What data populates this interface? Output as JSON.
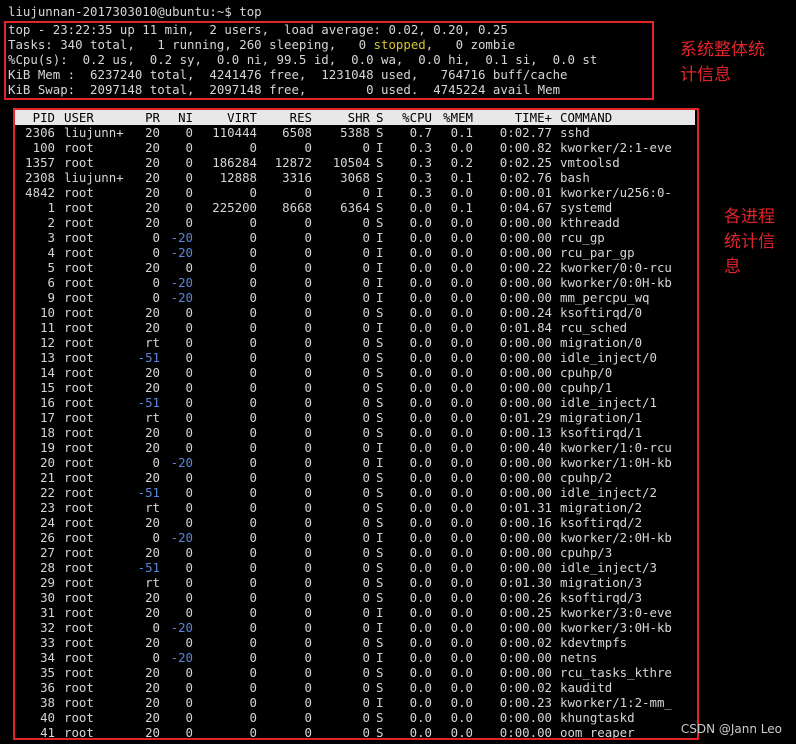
{
  "prompt": "liujunnan-2017303010@ubuntu:~$ top",
  "summary": {
    "line1": "top - 23:22:35 up 11 min,  2 users,  load average: 0.02, 0.20, 0.25",
    "line2_pre": "Tasks: 340 total,   1 running, 260 sleeping,   0 ",
    "line2_stopped": "stopped",
    "line2_post": ",   0 zombie",
    "line3": "%Cpu(s):  0.2 us,  0.2 sy,  0.0 ni, 99.5 id,  0.0 wa,  0.0 hi,  0.1 si,  0.0 st",
    "line4": "KiB Mem :  6237240 total,  4241476 free,  1231048 used,   764716 buff/cache",
    "line5": "KiB Swap:  2097148 total,  2097148 free,        0 used.  4745224 avail Mem"
  },
  "columns": [
    "PID",
    "USER",
    "PR",
    "NI",
    "VIRT",
    "RES",
    "SHR",
    "S",
    "%CPU",
    "%MEM",
    "TIME+",
    "COMMAND"
  ],
  "processes": [
    [
      "2306",
      "liujunn+",
      "20",
      "0",
      "110444",
      "6508",
      "5388",
      "S",
      "0.7",
      "0.1",
      "0:02.77",
      "sshd"
    ],
    [
      "100",
      "root",
      "20",
      "0",
      "0",
      "0",
      "0",
      "I",
      "0.3",
      "0.0",
      "0:00.82",
      "kworker/2:1-eve"
    ],
    [
      "1357",
      "root",
      "20",
      "0",
      "186284",
      "12872",
      "10504",
      "S",
      "0.3",
      "0.2",
      "0:02.25",
      "vmtoolsd"
    ],
    [
      "2308",
      "liujunn+",
      "20",
      "0",
      "12888",
      "3316",
      "3068",
      "S",
      "0.3",
      "0.1",
      "0:02.76",
      "bash"
    ],
    [
      "4842",
      "root",
      "20",
      "0",
      "0",
      "0",
      "0",
      "I",
      "0.3",
      "0.0",
      "0:00.01",
      "kworker/u256:0-"
    ],
    [
      "1",
      "root",
      "20",
      "0",
      "225200",
      "8668",
      "6364",
      "S",
      "0.0",
      "0.1",
      "0:04.67",
      "systemd"
    ],
    [
      "2",
      "root",
      "20",
      "0",
      "0",
      "0",
      "0",
      "S",
      "0.0",
      "0.0",
      "0:00.00",
      "kthreadd"
    ],
    [
      "3",
      "root",
      "0",
      "-20",
      "0",
      "0",
      "0",
      "I",
      "0.0",
      "0.0",
      "0:00.00",
      "rcu_gp"
    ],
    [
      "4",
      "root",
      "0",
      "-20",
      "0",
      "0",
      "0",
      "I",
      "0.0",
      "0.0",
      "0:00.00",
      "rcu_par_gp"
    ],
    [
      "5",
      "root",
      "20",
      "0",
      "0",
      "0",
      "0",
      "I",
      "0.0",
      "0.0",
      "0:00.22",
      "kworker/0:0-rcu"
    ],
    [
      "6",
      "root",
      "0",
      "-20",
      "0",
      "0",
      "0",
      "I",
      "0.0",
      "0.0",
      "0:00.00",
      "kworker/0:0H-kb"
    ],
    [
      "9",
      "root",
      "0",
      "-20",
      "0",
      "0",
      "0",
      "I",
      "0.0",
      "0.0",
      "0:00.00",
      "mm_percpu_wq"
    ],
    [
      "10",
      "root",
      "20",
      "0",
      "0",
      "0",
      "0",
      "S",
      "0.0",
      "0.0",
      "0:00.24",
      "ksoftirqd/0"
    ],
    [
      "11",
      "root",
      "20",
      "0",
      "0",
      "0",
      "0",
      "I",
      "0.0",
      "0.0",
      "0:01.84",
      "rcu_sched"
    ],
    [
      "12",
      "root",
      "rt",
      "0",
      "0",
      "0",
      "0",
      "S",
      "0.0",
      "0.0",
      "0:00.00",
      "migration/0"
    ],
    [
      "13",
      "root",
      "-51",
      "0",
      "0",
      "0",
      "0",
      "S",
      "0.0",
      "0.0",
      "0:00.00",
      "idle_inject/0"
    ],
    [
      "14",
      "root",
      "20",
      "0",
      "0",
      "0",
      "0",
      "S",
      "0.0",
      "0.0",
      "0:00.00",
      "cpuhp/0"
    ],
    [
      "15",
      "root",
      "20",
      "0",
      "0",
      "0",
      "0",
      "S",
      "0.0",
      "0.0",
      "0:00.00",
      "cpuhp/1"
    ],
    [
      "16",
      "root",
      "-51",
      "0",
      "0",
      "0",
      "0",
      "S",
      "0.0",
      "0.0",
      "0:00.00",
      "idle_inject/1"
    ],
    [
      "17",
      "root",
      "rt",
      "0",
      "0",
      "0",
      "0",
      "S",
      "0.0",
      "0.0",
      "0:01.29",
      "migration/1"
    ],
    [
      "18",
      "root",
      "20",
      "0",
      "0",
      "0",
      "0",
      "S",
      "0.0",
      "0.0",
      "0:00.13",
      "ksoftirqd/1"
    ],
    [
      "19",
      "root",
      "20",
      "0",
      "0",
      "0",
      "0",
      "I",
      "0.0",
      "0.0",
      "0:00.40",
      "kworker/1:0-rcu"
    ],
    [
      "20",
      "root",
      "0",
      "-20",
      "0",
      "0",
      "0",
      "I",
      "0.0",
      "0.0",
      "0:00.00",
      "kworker/1:0H-kb"
    ],
    [
      "21",
      "root",
      "20",
      "0",
      "0",
      "0",
      "0",
      "S",
      "0.0",
      "0.0",
      "0:00.00",
      "cpuhp/2"
    ],
    [
      "22",
      "root",
      "-51",
      "0",
      "0",
      "0",
      "0",
      "S",
      "0.0",
      "0.0",
      "0:00.00",
      "idle_inject/2"
    ],
    [
      "23",
      "root",
      "rt",
      "0",
      "0",
      "0",
      "0",
      "S",
      "0.0",
      "0.0",
      "0:01.31",
      "migration/2"
    ],
    [
      "24",
      "root",
      "20",
      "0",
      "0",
      "0",
      "0",
      "S",
      "0.0",
      "0.0",
      "0:00.16",
      "ksoftirqd/2"
    ],
    [
      "26",
      "root",
      "0",
      "-20",
      "0",
      "0",
      "0",
      "I",
      "0.0",
      "0.0",
      "0:00.00",
      "kworker/2:0H-kb"
    ],
    [
      "27",
      "root",
      "20",
      "0",
      "0",
      "0",
      "0",
      "S",
      "0.0",
      "0.0",
      "0:00.00",
      "cpuhp/3"
    ],
    [
      "28",
      "root",
      "-51",
      "0",
      "0",
      "0",
      "0",
      "S",
      "0.0",
      "0.0",
      "0:00.00",
      "idle_inject/3"
    ],
    [
      "29",
      "root",
      "rt",
      "0",
      "0",
      "0",
      "0",
      "S",
      "0.0",
      "0.0",
      "0:01.30",
      "migration/3"
    ],
    [
      "30",
      "root",
      "20",
      "0",
      "0",
      "0",
      "0",
      "S",
      "0.0",
      "0.0",
      "0:00.26",
      "ksoftirqd/3"
    ],
    [
      "31",
      "root",
      "20",
      "0",
      "0",
      "0",
      "0",
      "I",
      "0.0",
      "0.0",
      "0:00.25",
      "kworker/3:0-eve"
    ],
    [
      "32",
      "root",
      "0",
      "-20",
      "0",
      "0",
      "0",
      "I",
      "0.0",
      "0.0",
      "0:00.00",
      "kworker/3:0H-kb"
    ],
    [
      "33",
      "root",
      "20",
      "0",
      "0",
      "0",
      "0",
      "S",
      "0.0",
      "0.0",
      "0:00.02",
      "kdevtmpfs"
    ],
    [
      "34",
      "root",
      "0",
      "-20",
      "0",
      "0",
      "0",
      "I",
      "0.0",
      "0.0",
      "0:00.00",
      "netns"
    ],
    [
      "35",
      "root",
      "20",
      "0",
      "0",
      "0",
      "0",
      "S",
      "0.0",
      "0.0",
      "0:00.00",
      "rcu_tasks_kthre"
    ],
    [
      "36",
      "root",
      "20",
      "0",
      "0",
      "0",
      "0",
      "S",
      "0.0",
      "0.0",
      "0:00.02",
      "kauditd"
    ],
    [
      "38",
      "root",
      "20",
      "0",
      "0",
      "0",
      "0",
      "I",
      "0.0",
      "0.0",
      "0:00.23",
      "kworker/1:2-mm_"
    ],
    [
      "40",
      "root",
      "20",
      "0",
      "0",
      "0",
      "0",
      "S",
      "0.0",
      "0.0",
      "0:00.00",
      "khungtaskd"
    ],
    [
      "41",
      "root",
      "20",
      "0",
      "0",
      "0",
      "0",
      "S",
      "0.0",
      "0.0",
      "0:00.00",
      "oom_reaper"
    ]
  ],
  "annotations": {
    "summary_note": "系统整体统计信息",
    "process_note": "各进程统计信息"
  },
  "watermark": "CSDN @Jann Leo",
  "colors": {
    "highlight_box": "#e0242a",
    "negative_priority": "#5a86d6",
    "stopped_text": "#d6c234"
  }
}
